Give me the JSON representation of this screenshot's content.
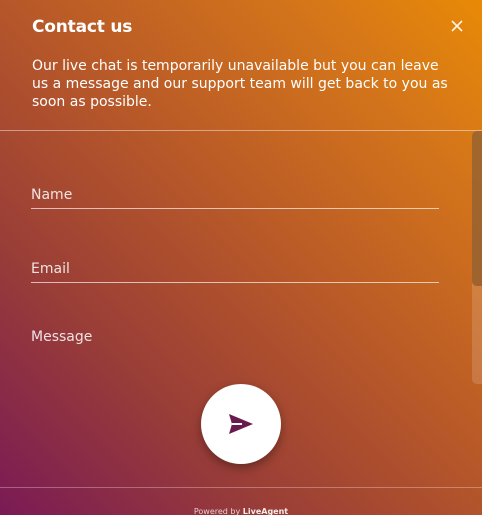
{
  "header": {
    "title": "Contact us",
    "subtitle": "Our live chat is temporarily unavailable but you can leave us a message and our support team will get back to you as soon as possible.",
    "close_icon": "close-icon"
  },
  "form": {
    "name_placeholder": "Name",
    "email_placeholder": "Email",
    "message_placeholder": "Message"
  },
  "send_icon": "send-icon",
  "footer": {
    "powered_prefix": "Powered by",
    "brand": "LiveAgent"
  },
  "colors": {
    "gradient_top_right": "#e88a06",
    "gradient_bottom_left": "#7a1a55",
    "send_icon": "#6b1a4f",
    "button_bg": "#ffffff"
  }
}
